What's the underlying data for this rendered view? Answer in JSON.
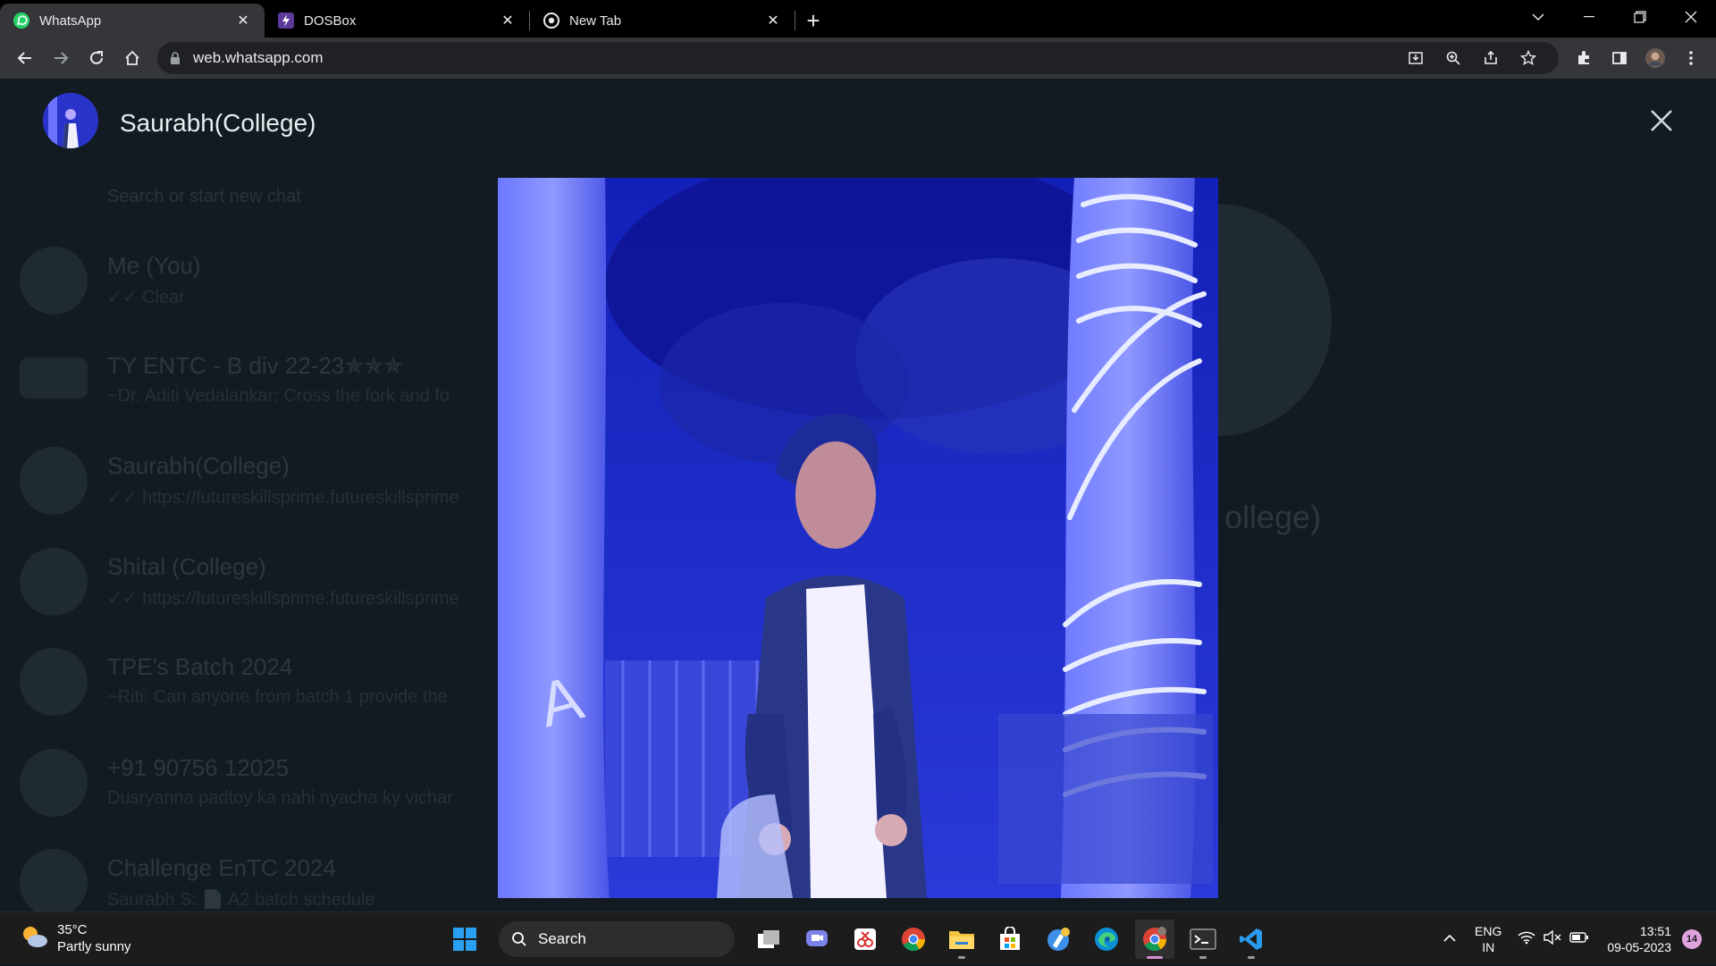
{
  "browser": {
    "tabs": [
      {
        "title": "WhatsApp",
        "icon": "whatsapp-icon",
        "active": true
      },
      {
        "title": "DOSBox",
        "icon": "dosbox-icon",
        "active": false
      },
      {
        "title": "New Tab",
        "icon": "chrome-icon",
        "active": false
      }
    ],
    "url": "web.whatsapp.com"
  },
  "viewer": {
    "contact_name": "Saurabh(College)",
    "image_description_icon": "profile-photo"
  },
  "background": {
    "search_placeholder": "Search or start new chat",
    "chats": [
      {
        "name": "Me (You)",
        "message": "✓✓ Clear"
      },
      {
        "name": "TY ENTC - B div 22-23✯✯✯",
        "message": "~Dr. Aditi Vedalankar: Cross the  fork and fo"
      },
      {
        "name": "Saurabh(College)",
        "message": "✓✓ https://futureskillsprime.futureskillsprime"
      },
      {
        "name": "Shital (College)",
        "message": "✓✓ https://futureskillsprime.futureskillsprime"
      },
      {
        "name": "TPE's Batch 2024",
        "message": "~Riti: Can anyone from batch 1 provide the"
      },
      {
        "name": "+91 90756 12025",
        "message": "Dusryanna padtoy ka nahi nyacha ky vichar"
      },
      {
        "name": "Challenge EnTC 2024",
        "message": "Saurabh S: 📄 A2 batch schedule"
      }
    ],
    "profile_name_partial": "ollege)"
  },
  "taskbar": {
    "weather_temp": "35°C",
    "weather_desc": "Partly sunny",
    "search_label": "Search",
    "lang_top": "ENG",
    "lang_bottom": "IN",
    "time": "13:51",
    "date": "09-05-2023",
    "notification_count": "14"
  }
}
